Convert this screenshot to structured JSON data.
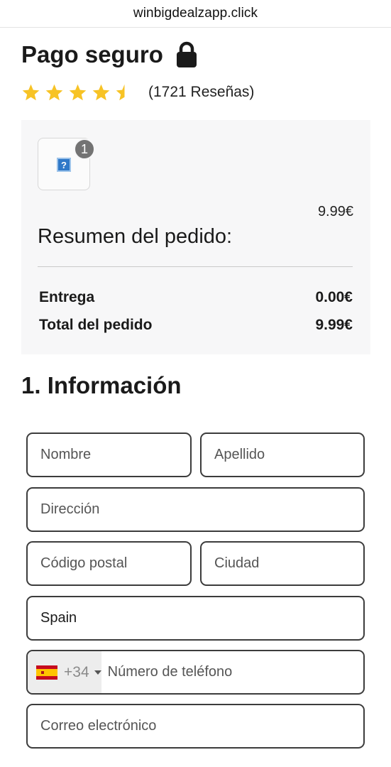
{
  "browser": {
    "url": "winbigdealzapp.click"
  },
  "header": {
    "title": "Pago seguro",
    "lock_icon": "lock-icon"
  },
  "rating": {
    "stars": 4.5,
    "max_stars": 5,
    "reviews_text": "(1721 Reseñas)",
    "star_color": "#f7c325"
  },
  "summary": {
    "item_quantity": "1",
    "item_image_placeholder": "?",
    "item_price": "9.99€",
    "title": "Resumen del pedido:",
    "delivery_label": "Entrega",
    "delivery_value": "0.00€",
    "total_label": "Total del pedido",
    "total_value": "9.99€"
  },
  "form": {
    "section_title": "1. Información",
    "first_name_placeholder": "Nombre",
    "last_name_placeholder": "Apellido",
    "address_placeholder": "Dirección",
    "postal_code_placeholder": "Código postal",
    "city_placeholder": "Ciudad",
    "country_value": "Spain",
    "phone_country_flag": "spain-flag-icon",
    "phone_dial_code": "+34",
    "phone_placeholder": "Número de teléfono",
    "email_placeholder": "Correo electrónico"
  }
}
